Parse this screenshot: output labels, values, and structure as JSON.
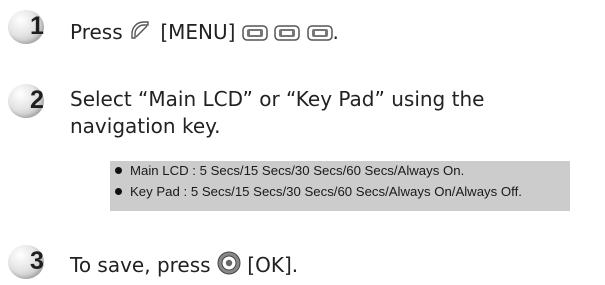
{
  "steps": [
    {
      "number": "1",
      "text_before": "Press ",
      "menu_key_label": "[MENU]",
      "icons": [
        "menu-key-icon",
        "menu-icon",
        "menu-icon",
        "menu-icon"
      ],
      "text_after": "."
    },
    {
      "number": "2",
      "line1": "Select “Main LCD” or “Key Pad” using the",
      "line2": "navigation key."
    },
    {
      "number": "3",
      "text_before": "To save, press ",
      "ok_key_label": "[OK]",
      "icons": [
        "ok-key-icon"
      ],
      "text_after": "."
    }
  ],
  "notes": [
    "Main LCD : 5 Secs/15 Secs/30 Secs/60 Secs/Always On.",
    "Key Pad : 5 Secs/15 Secs/30 Secs/60 Secs/Always On/Always Off."
  ],
  "colors": {
    "note_background": "#cccccc",
    "badge_gray": "#d6d6d6",
    "text": "#222222"
  }
}
